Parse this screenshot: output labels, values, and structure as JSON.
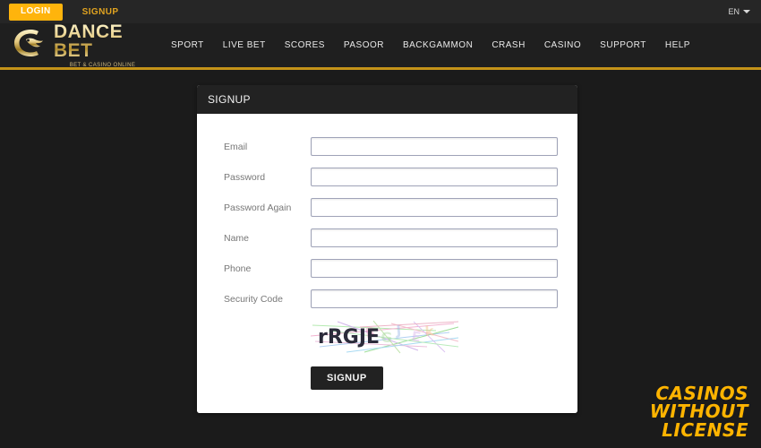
{
  "topbar": {
    "login_label": "LOGIN",
    "signup_label": "SIGNUP",
    "language": "EN",
    "caret_icon": "chevron-down-icon"
  },
  "header": {
    "logo": {
      "emblem_icon": "dance-bet-emblem-icon",
      "title": "DANCE BET",
      "tagline": "BET  & CASINO ONLINE"
    },
    "nav": [
      {
        "label": "SPORT"
      },
      {
        "label": "LIVE BET"
      },
      {
        "label": "SCORES"
      },
      {
        "label": "PASOOR"
      },
      {
        "label": "BACKGAMMON"
      },
      {
        "label": "CRASH"
      },
      {
        "label": "CASINO"
      },
      {
        "label": "SUPPORT"
      },
      {
        "label": "HELP"
      }
    ]
  },
  "signup_panel": {
    "title": "SIGNUP",
    "fields": [
      {
        "label": "Email",
        "value": "",
        "placeholder": ""
      },
      {
        "label": "Password",
        "value": "",
        "placeholder": ""
      },
      {
        "label": "Password Again",
        "value": "",
        "placeholder": ""
      },
      {
        "label": "Name",
        "value": "",
        "placeholder": ""
      },
      {
        "label": "Phone",
        "value": "",
        "placeholder": ""
      },
      {
        "label": "Security Code",
        "value": "",
        "placeholder": ""
      }
    ],
    "captcha_text": "rRGJE",
    "submit_label": "SIGNUP"
  },
  "watermark": {
    "line1": "CASINOS",
    "line2": "WITHOUT",
    "line3": "LICENSE"
  },
  "colors": {
    "accent_gold": "#ffb40c",
    "header_rule": "#c49319",
    "page_bg": "#1b1b1b",
    "panel_head_bg": "#222222"
  }
}
